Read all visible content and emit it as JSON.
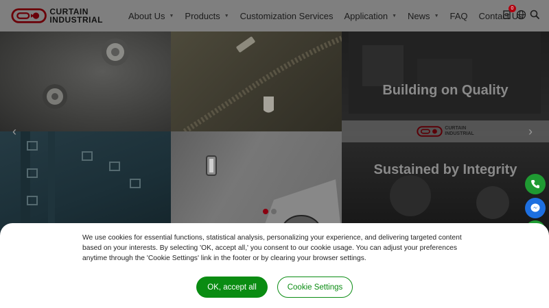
{
  "brand": {
    "line1": "CURTAIN",
    "line2": "INDUSTRIAL",
    "color": "#b0000f"
  },
  "nav": {
    "items": [
      {
        "label": "About Us",
        "has_dropdown": true
      },
      {
        "label": "Products",
        "has_dropdown": true
      },
      {
        "label": "Customization Services",
        "has_dropdown": false
      },
      {
        "label": "Application",
        "has_dropdown": true
      },
      {
        "label": "News",
        "has_dropdown": true
      },
      {
        "label": "FAQ",
        "has_dropdown": false
      },
      {
        "label": "Contact Us",
        "has_dropdown": false
      }
    ],
    "caret": "▼",
    "icons": [
      "inquiry-icon",
      "globe-icon",
      "search-icon"
    ],
    "inquiry_count": "0"
  },
  "hero": {
    "tagline_1": "Building on Quality",
    "tagline_2": "Sustained by Integrity",
    "band_logo": {
      "line1": "CURTAIN",
      "line2": "INDUSTRIAL"
    },
    "prev": "‹",
    "next": "›",
    "slide_count": 2,
    "active_slide": 1
  },
  "floating": [
    "phone-icon",
    "messenger-icon",
    "chat-icon"
  ],
  "cookie": {
    "text": "We use cookies for essential functions, statistical analysis, personalizing your experience, and delivering targeted content based on your interests. By selecting 'OK, accept all,' you consent to our cookie usage. You can adjust your preferences anytime through the 'Cookie Settings' link in the footer or by clearing your browser settings.",
    "accept_label": "OK, accept all",
    "settings_label": "Cookie Settings",
    "accent_color": "#0a8c12"
  }
}
